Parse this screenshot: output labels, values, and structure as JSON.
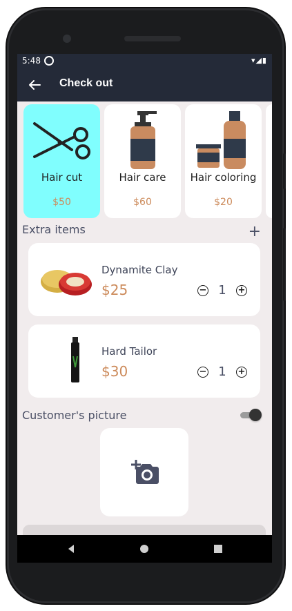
{
  "status_bar": {
    "time": "5:48",
    "icons": "▾◢▮"
  },
  "app_bar": {
    "title": "Check out"
  },
  "services": [
    {
      "name": "Hair cut",
      "price": "$50",
      "selected": true,
      "icon": "scissors-icon"
    },
    {
      "name": "Hair care",
      "price": "$60",
      "selected": false,
      "icon": "pump-bottle-icon"
    },
    {
      "name": "Hair coloring",
      "price": "$20",
      "selected": false,
      "icon": "bottles-icon"
    }
  ],
  "extra_items": {
    "title": "Extra items",
    "add_icon": "+",
    "items": [
      {
        "name": "Dynamite Clay",
        "price": "$25",
        "quantity": "1",
        "image": "pomade-tin"
      },
      {
        "name": "Hard Tailor",
        "price": "$30",
        "quantity": "1",
        "image": "hair-spray-bottle"
      }
    ]
  },
  "customer_picture": {
    "title": "Customer's picture",
    "toggle_on": true,
    "icon": "add-photo-icon"
  },
  "colors": {
    "app_bar": "#242a38",
    "accent": "#cc8a5a",
    "selected_card": "#80fefe",
    "background": "#f1eced"
  }
}
